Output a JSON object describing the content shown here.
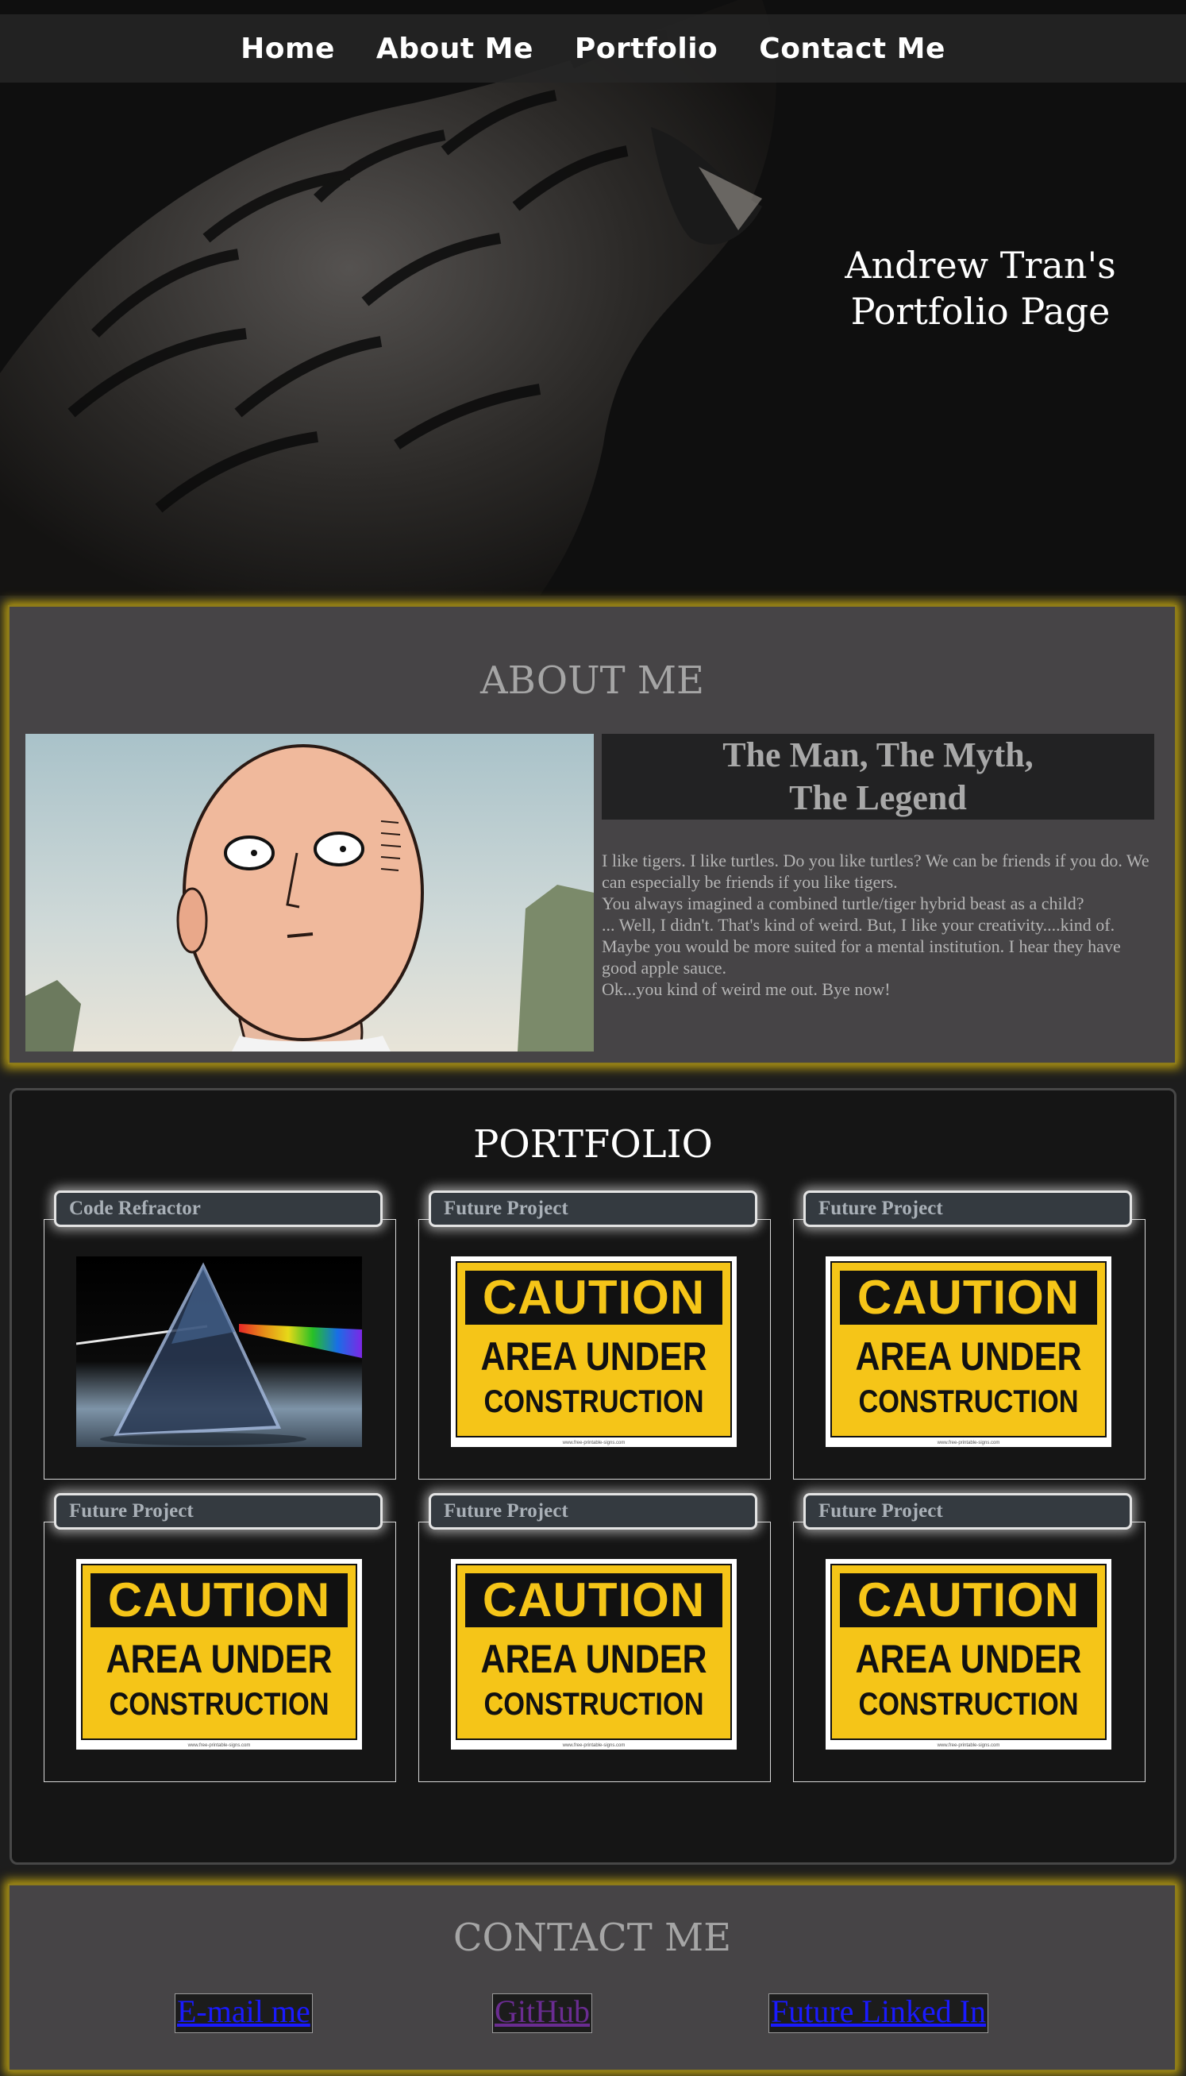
{
  "nav": {
    "items": [
      {
        "label": "Home"
      },
      {
        "label": "About Me"
      },
      {
        "label": "Portfolio"
      },
      {
        "label": "Contact Me"
      }
    ]
  },
  "hero": {
    "title_line1": "Andrew Tran's",
    "title_line2": "Portfolio Page"
  },
  "about": {
    "heading": "ABOUT ME",
    "subheading_line1": "The Man, The Myth,",
    "subheading_line2": "The Legend",
    "paragraphs": [
      "I like tigers. I like turtles. Do you like turtles? We can be friends if you do. We can especially be friends if you like tigers.",
      "You always imagined a combined turtle/tiger hybrid beast as a child?",
      "... Well, I didn't. That's kind of weird. But, I like your creativity....kind of.",
      "Maybe you would be more suited for a mental institution. I hear they have good apple sauce.",
      "Ok...you kind of weird me out. Bye now!"
    ]
  },
  "portfolio": {
    "heading": "PORTFOLIO",
    "cards": [
      {
        "title": "Code Refractor",
        "image": "prism-image"
      },
      {
        "title": "Future Project",
        "image": "caution-sign"
      },
      {
        "title": "Future Project",
        "image": "caution-sign"
      },
      {
        "title": "Future Project",
        "image": "caution-sign"
      },
      {
        "title": "Future Project",
        "image": "caution-sign"
      },
      {
        "title": "Future Project",
        "image": "caution-sign"
      }
    ],
    "caution": {
      "word": "CAUTION",
      "line1": "AREA UNDER",
      "line2": "CONSTRUCTION",
      "footer": "www.free-printable-signs.com"
    }
  },
  "contact": {
    "heading": "CONTACT ME",
    "links": [
      {
        "label": "E-mail me",
        "color": "#1a1aff"
      },
      {
        "label": "GitHub",
        "color": "#6a2c91"
      },
      {
        "label": "Future Linked In",
        "color": "#1a1aff"
      }
    ]
  },
  "colors": {
    "accent_glow": "#b59b12",
    "section_bg": "#464446",
    "portfolio_bg": "#151515",
    "card_tab_bg": "#343a40"
  }
}
